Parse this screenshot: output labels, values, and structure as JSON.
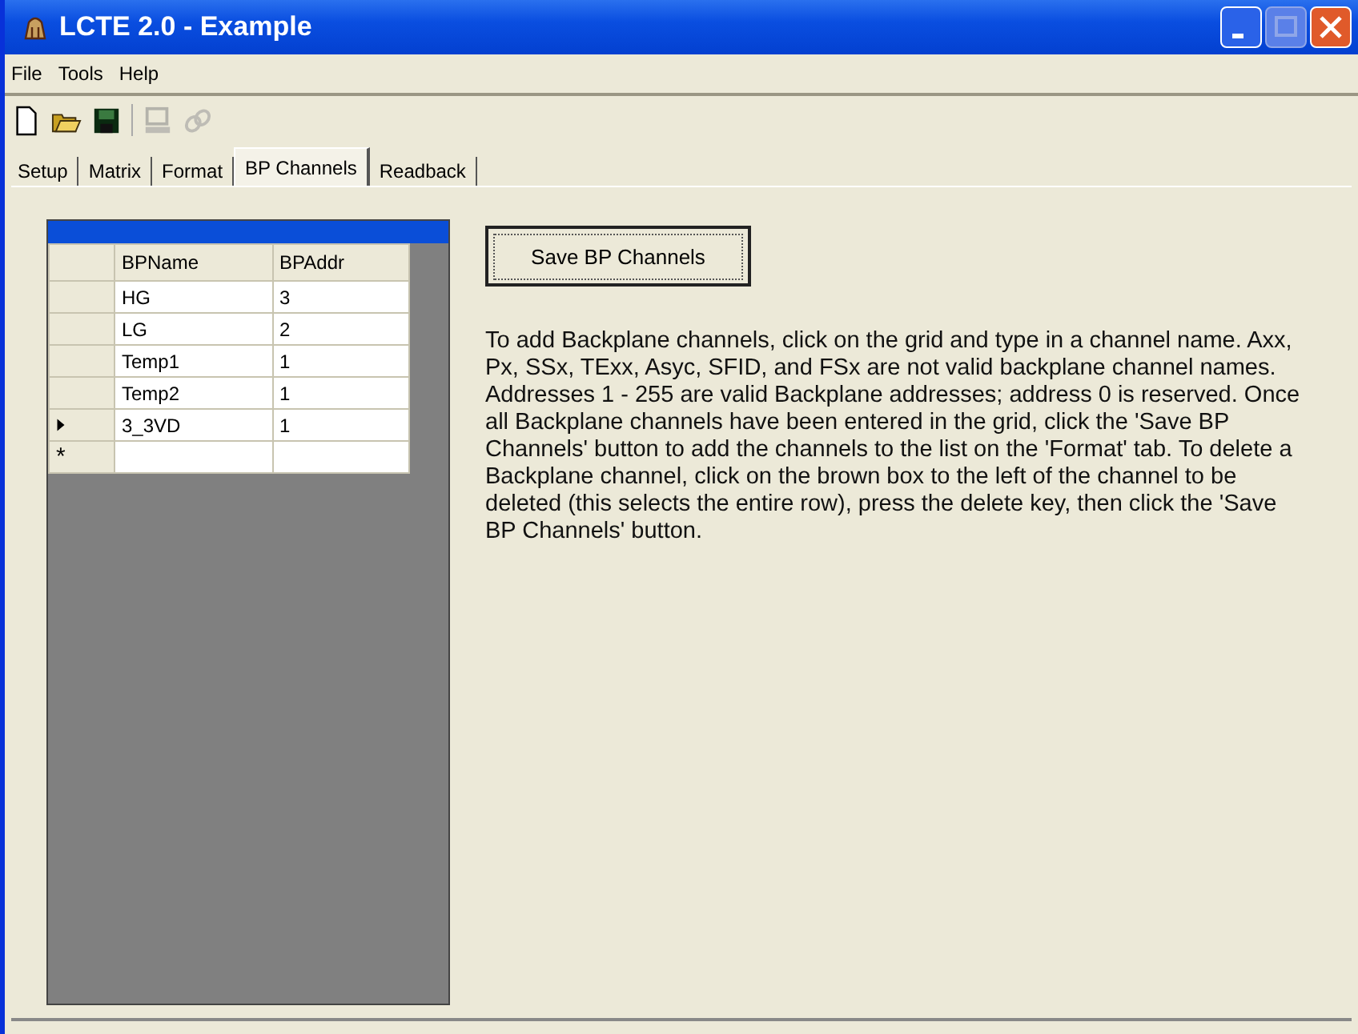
{
  "window": {
    "title": "LCTE 2.0 - Example"
  },
  "menu": [
    "File",
    "Tools",
    "Help"
  ],
  "toolbar": [
    {
      "kind": "new",
      "disabled": false
    },
    {
      "kind": "open",
      "disabled": false
    },
    {
      "kind": "save",
      "disabled": false
    },
    {
      "kind": "computer",
      "disabled": true
    },
    {
      "kind": "link",
      "disabled": true
    }
  ],
  "tabs": [
    {
      "label": "Setup",
      "selected": false
    },
    {
      "label": "Matrix",
      "selected": false
    },
    {
      "label": "Format",
      "selected": false
    },
    {
      "label": "BP Channels",
      "selected": true
    },
    {
      "label": "Readback",
      "selected": false
    }
  ],
  "grid": {
    "columns": [
      "BPName",
      "BPAddr"
    ],
    "rows": [
      {
        "kind": "data",
        "cells": [
          "HG",
          "3"
        ],
        "current": false
      },
      {
        "kind": "data",
        "cells": [
          "LG",
          "2"
        ],
        "current": false
      },
      {
        "kind": "data",
        "cells": [
          "Temp1",
          "1"
        ],
        "current": false
      },
      {
        "kind": "data",
        "cells": [
          "Temp2",
          "1"
        ],
        "current": false
      },
      {
        "kind": "data",
        "cells": [
          "3_3VD",
          "1"
        ],
        "current": true
      },
      {
        "kind": "new",
        "marker": "*"
      }
    ]
  },
  "save_button": "Save BP Channels",
  "instructions": "To add Backplane channels, click on the grid and type in a channel name.  Axx, Px, SSx, TExx, Asyc, SFID, and FSx are not valid backplane channel names.  Addresses 1 - 255 are valid Backplane addresses; address 0 is reserved.  Once all Backplane channels have been entered in the grid, click the 'Save BP Channels' button to add the channels to the list on the 'Format' tab.  To delete a Backplane channel, click on the brown box to the left of the channel to be deleted (this selects the entire row), press the delete key, then click the 'Save BP Channels' button."
}
